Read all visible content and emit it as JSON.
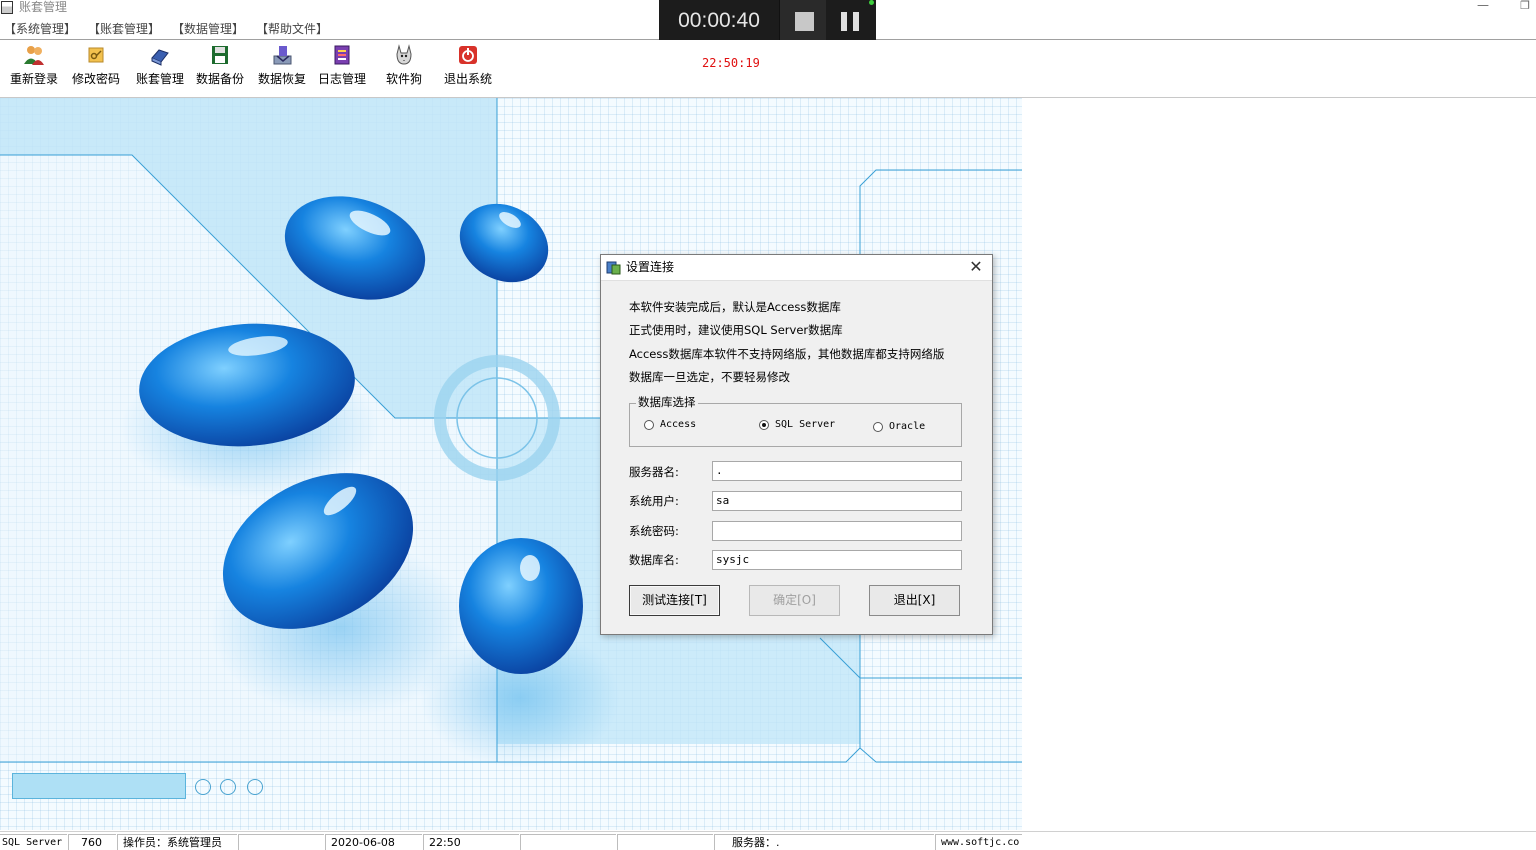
{
  "window": {
    "title": "账套管理"
  },
  "menu": {
    "items": [
      "【系统管理】",
      "【账套管理】",
      "【数据管理】",
      "【帮助文件】"
    ]
  },
  "recorder": {
    "elapsed": "00:00:40"
  },
  "toolbar": {
    "items": [
      {
        "label": "重新登录",
        "icon": "users-icon"
      },
      {
        "label": "修改密码",
        "icon": "key-icon"
      },
      {
        "label": "账套管理",
        "icon": "books-icon"
      },
      {
        "label": "数据备份",
        "icon": "save-icon"
      },
      {
        "label": "数据恢复",
        "icon": "restore-icon"
      },
      {
        "label": "日志管理",
        "icon": "log-icon"
      },
      {
        "label": "软件狗",
        "icon": "dog-icon"
      },
      {
        "label": "退出系统",
        "icon": "power-icon"
      }
    ],
    "clock": "22:50:19"
  },
  "dialog": {
    "title": "设置连接",
    "info": [
      "本软件安装完成后，默认是Access数据库",
      "正式使用时，建议使用SQL Server数据库",
      "Access数据库本软件不支持网络版，其他数据库都支持网络版",
      "数据库一旦选定，不要轻易修改"
    ],
    "db_group": {
      "legend": "数据库选择",
      "options": [
        "Access",
        "SQL Server",
        "Oracle"
      ],
      "selected": "SQL Server"
    },
    "fields": {
      "server": {
        "label": "服务器名:",
        "value": "."
      },
      "user": {
        "label": "系统用户:",
        "value": "sa"
      },
      "password": {
        "label": "系统密码:",
        "value": ""
      },
      "database": {
        "label": "数据库名:",
        "value": "sysjc"
      }
    },
    "buttons": {
      "test": "测试连接[T]",
      "ok": "确定[O]",
      "exit": "退出[X]"
    }
  },
  "status": {
    "db": "SQL Server",
    "code": "760",
    "operator": "操作员：系统管理员",
    "date": "2020-06-08",
    "time": "22:50",
    "server": "服务器：.",
    "website": "www.softjc.co"
  },
  "colors": {
    "clock": "#e01010",
    "art_blue": "#1a7fd6",
    "panel_blue": "#bde4f7"
  }
}
